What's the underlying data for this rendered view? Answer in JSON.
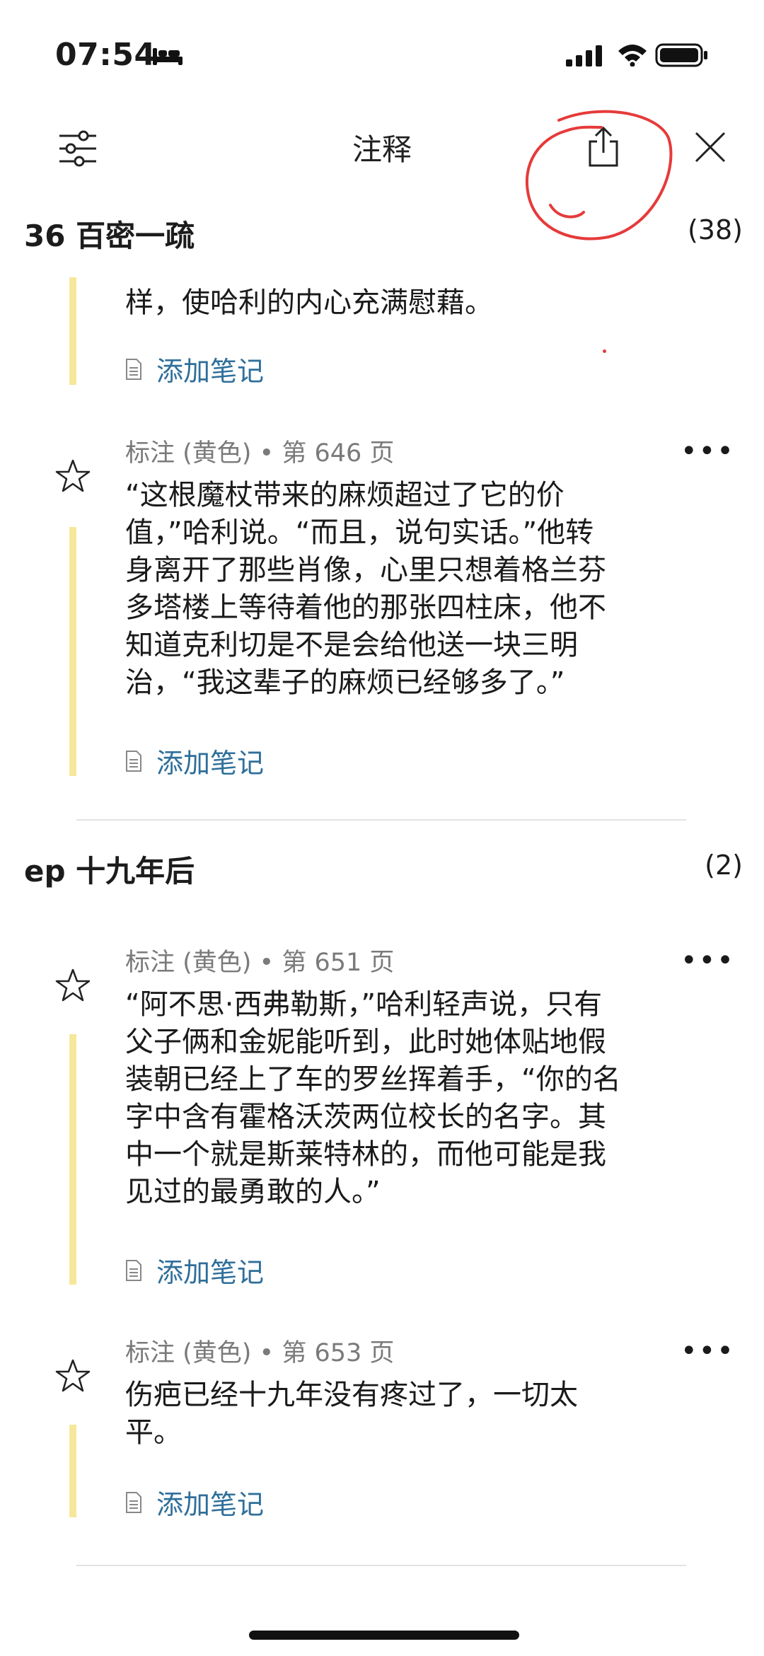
{
  "status_bar": {
    "time": "07:54"
  },
  "header": {
    "title": "注释"
  },
  "sections": [
    {
      "title": "36 百密一疏",
      "count": "(38)",
      "items": [
        {
          "quote_lines": [
            "样，使哈利的内心充满慰藉。"
          ],
          "add_note": "添加笔记"
        },
        {
          "meta": "标注 (黄色) • 第 646 页",
          "quote_lines": [
            "“这根魔杖带来的麻烦超过了它的价",
            "值，”哈利说。“而且，说句实话。”他转",
            "身离开了那些肖像，心里只想着格兰芬",
            "多塔楼上等待着他的那张四柱床，他不",
            "知道克利切是不是会给他送一块三明",
            "治，“我这辈子的麻烦已经够多了。”"
          ],
          "add_note": "添加笔记"
        }
      ]
    },
    {
      "title": "ep 十九年后",
      "count": "(2)",
      "items": [
        {
          "meta": "标注 (黄色) • 第 651 页",
          "quote_lines": [
            "“阿不思·西弗勒斯，”哈利轻声说，只有",
            "父子俩和金妮能听到，此时她体贴地假",
            "装朝已经上了车的罗丝挥着手，“你的名",
            "字中含有霍格沃茨两位校长的名字。其",
            "中一个就是斯莱特林的，而他可能是我",
            "见过的最勇敢的人。”"
          ],
          "add_note": "添加笔记"
        },
        {
          "meta": "标注 (黄色) • 第 653 页",
          "quote_lines": [
            "伤疤已经十九年没有疼过了，一切太",
            "平。"
          ],
          "add_note": "添加笔记"
        }
      ]
    }
  ],
  "colors": {
    "highlight_bar": "#f6e89a",
    "link": "#2f6f9a",
    "annotation_circle": "#e63a3a"
  }
}
